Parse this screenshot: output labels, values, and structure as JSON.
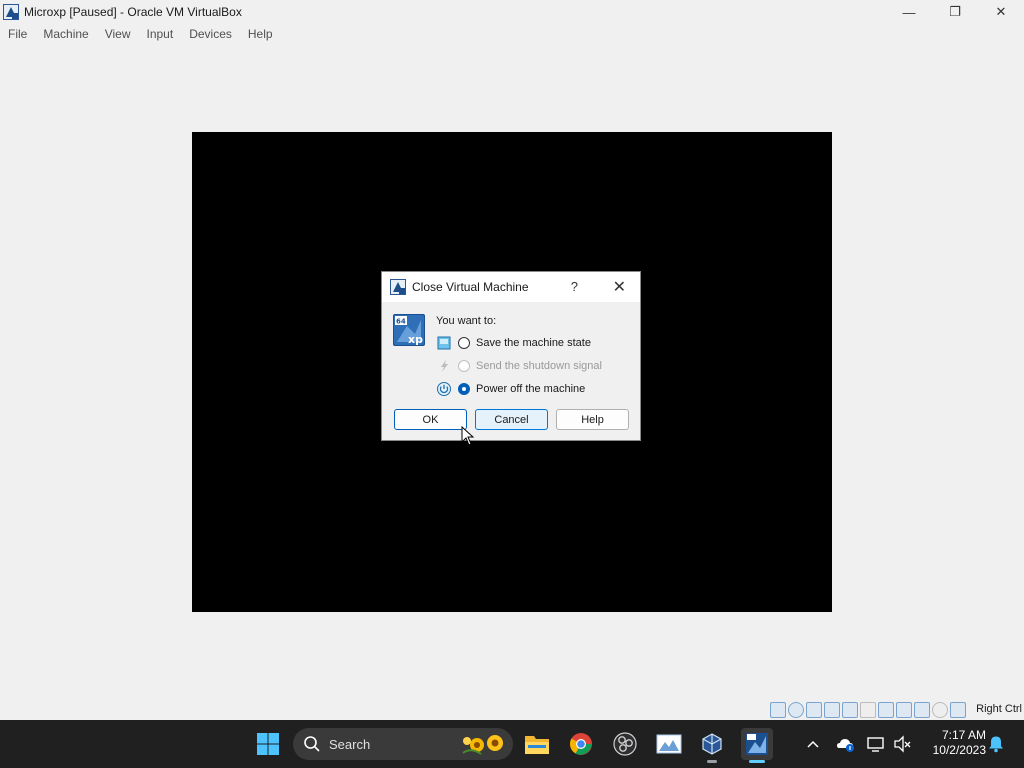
{
  "window": {
    "title": "Microxp [Paused] - Oracle VM VirtualBox",
    "controls": {
      "minimize": "—",
      "maximize": "❐",
      "close": "✕"
    }
  },
  "menu": [
    "File",
    "Machine",
    "View",
    "Input",
    "Devices",
    "Help"
  ],
  "dialog": {
    "title": "Close Virtual Machine",
    "help_glyph": "?",
    "close_glyph": "✕",
    "prompt": "You want to:",
    "options": [
      {
        "label": "Save the machine state",
        "checked": false,
        "enabled": true,
        "icon": "save-state-icon"
      },
      {
        "label": "Send the shutdown signal",
        "checked": false,
        "enabled": false,
        "icon": "shutdown-signal-icon"
      },
      {
        "label": "Power off the machine",
        "checked": true,
        "enabled": true,
        "icon": "power-off-icon"
      }
    ],
    "buttons": {
      "ok": "OK",
      "cancel": "Cancel",
      "help": "Help"
    }
  },
  "statusbar": {
    "icons": [
      "hard-disk-icon",
      "optical-drive-icon",
      "audio-icon",
      "network-icon",
      "usb-icon",
      "shared-folders-icon",
      "display-icon",
      "video-capture-icon",
      "cpu-icon",
      "mouse-integration-icon",
      "keyboard-icon"
    ],
    "host_key": "Right Ctrl"
  },
  "taskbar": {
    "search_placeholder": "Search",
    "apps": [
      "start-icon",
      "file-explorer-icon",
      "chrome-icon",
      "obs-icon",
      "image-viewer-icon",
      "virtualbox-icon",
      "microxp-vm-icon"
    ],
    "time": "7:17 AM",
    "date": "10/2/2023"
  },
  "colors": {
    "accent": "#005fb8",
    "vm_screen": "#000000",
    "taskbar": "#202020",
    "chrome": "#f0f0f0"
  }
}
